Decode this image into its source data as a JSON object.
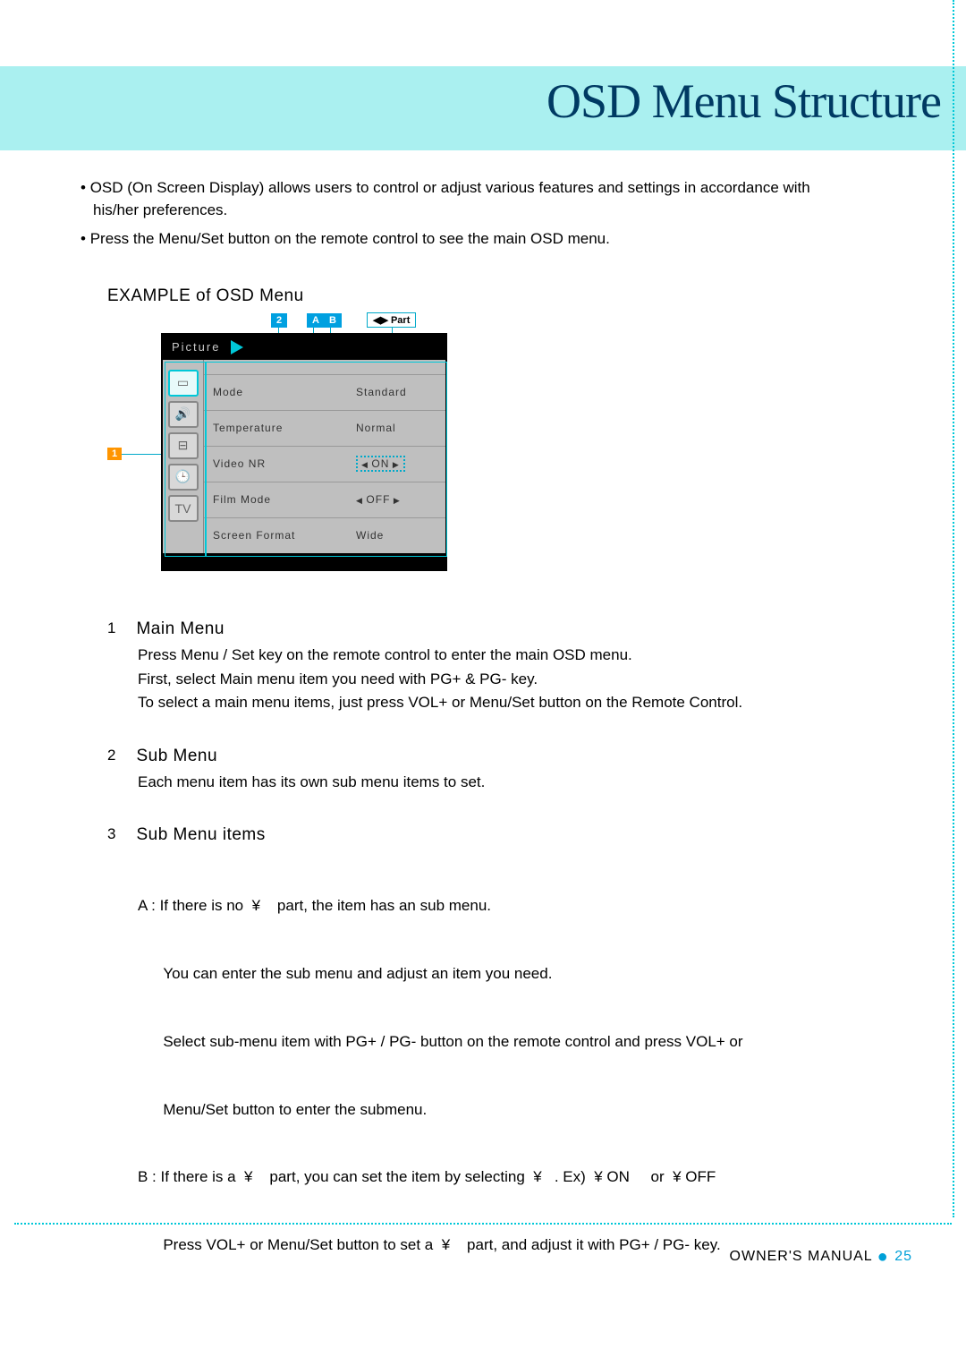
{
  "title": "OSD Menu Structure",
  "intro": [
    "OSD (On Screen Display) allows users to control or adjust various features and settings in accordance with his/her preferences.",
    "Press the Menu/Set button on the remote control to see the main OSD menu."
  ],
  "example_heading": "EXAMPLE of OSD Menu",
  "labels": {
    "l2": "2",
    "lA": "A",
    "lB": "B",
    "part": "◀▶ Part",
    "l1": "1"
  },
  "osd": {
    "header": "Picture",
    "rows": [
      {
        "label": "Mode",
        "value": "Standard",
        "arrows": false
      },
      {
        "label": "Temperature",
        "value": "Normal",
        "arrows": false
      },
      {
        "label": "Video NR",
        "value": "ON",
        "arrows": true,
        "dotted": true
      },
      {
        "label": "Film Mode",
        "value": "OFF",
        "arrows": true,
        "dotted": false
      },
      {
        "label": "Screen Format",
        "value": "Wide",
        "arrows": false
      }
    ]
  },
  "sections": [
    {
      "num": "1",
      "head": "Main Menu",
      "body": [
        "Press Menu / Set key on the remote control to enter the main OSD menu.",
        "First, select Main menu item you need with PG+ & PG- key.",
        "To select a main menu items, just press VOL+ or Menu/Set button on the Remote Control."
      ]
    },
    {
      "num": "2",
      "head": "Sub Menu",
      "body": [
        "Each menu item has its own sub menu items to set."
      ]
    },
    {
      "num": "3",
      "head": "Sub Menu items",
      "body": [
        "A : If there is no  ¥    part, the item has an sub menu.",
        "      You can enter the sub menu and adjust an item you need.",
        "      Select sub-menu item with PG+ / PG- button on the remote control and press VOL+ or",
        "      Menu/Set button to enter the submenu.",
        "B : If there is a  ¥    part, you can set the item by selecting  ¥   . Ex)  ¥ ON     or  ¥ OFF",
        "      Press VOL+ or Menu/Set button to set a  ¥    part, and adjust it with PG+ / PG- key."
      ]
    }
  ],
  "footer": {
    "label": "OWNER'S MANUAL",
    "page": "25"
  }
}
